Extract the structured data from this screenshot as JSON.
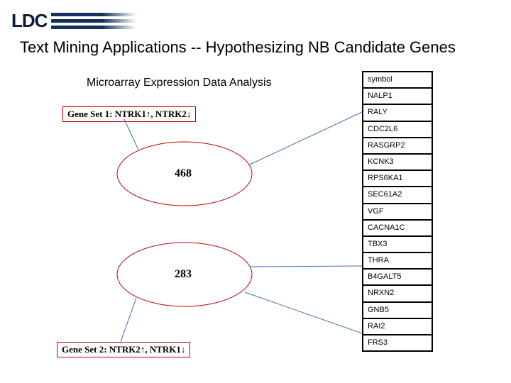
{
  "logo": {
    "text": "LDC"
  },
  "title": "Text Mining Applications -- Hypothesizing NB Candidate Genes",
  "subtitle": "Microarray Expression Data Analysis",
  "geneSet1": {
    "prefix": "Gene Set 1: NTRK1",
    "arrow1": "↑",
    "mid": ", NTRK2",
    "arrow2": "↓"
  },
  "geneSet2": {
    "prefix": "Gene Set 2: NTRK2",
    "arrow1": "↑",
    "mid": ", NTRK1",
    "arrow2": "↓"
  },
  "ellipse1": {
    "count": "468"
  },
  "ellipse2": {
    "count": "283"
  },
  "symbolTable": {
    "header": "symbol",
    "rows": [
      "NALP1",
      "RALY",
      "CDC2L6",
      "RASGRP2",
      "KCNK3",
      "RPS6KA1",
      "SEC61A2",
      "VGF",
      "CACNA1C",
      "TBX3",
      "THRA",
      "B4GALT5",
      "NRXN2",
      "GNB5",
      "RAI2",
      "FRS3"
    ]
  }
}
